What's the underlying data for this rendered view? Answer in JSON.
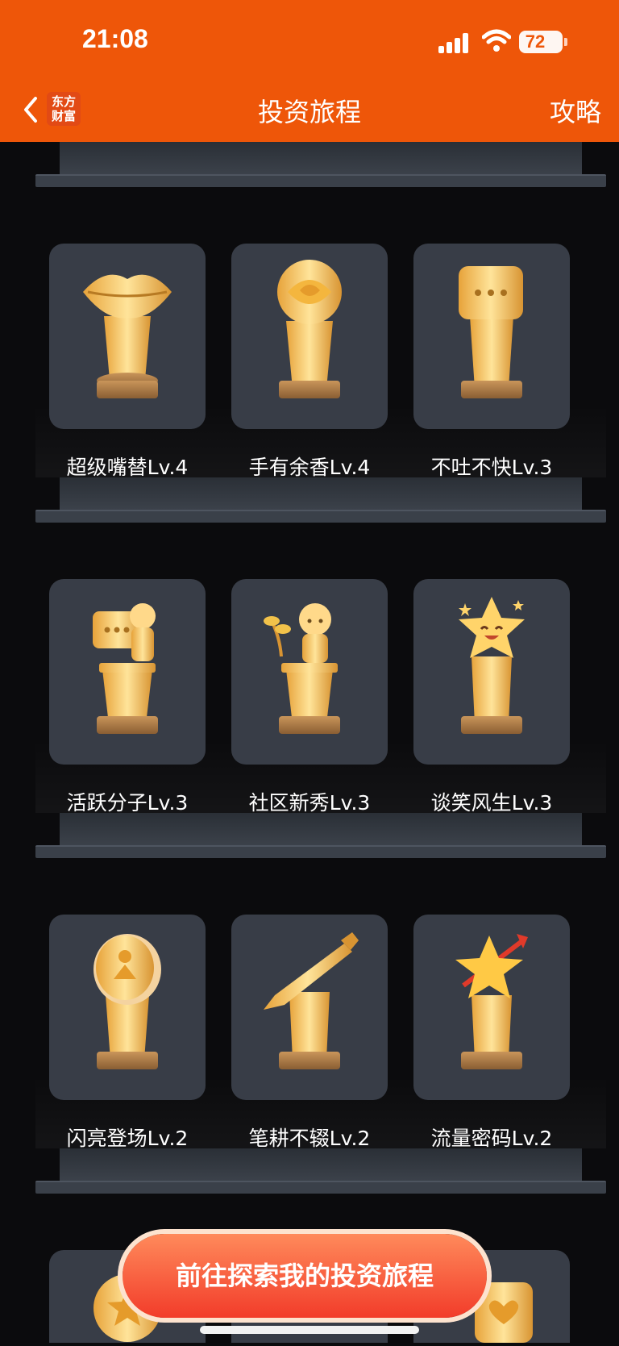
{
  "status": {
    "time": "21:08",
    "battery": "72"
  },
  "nav": {
    "logo": "东方财富",
    "title": "投资旅程",
    "action": "攻略"
  },
  "badges": [
    {
      "name": "超级嘴替Lv.4",
      "icon": "lips-trophy-icon"
    },
    {
      "name": "手有余香Lv.4",
      "icon": "rose-trophy-icon"
    },
    {
      "name": "不吐不快Lv.3",
      "icon": "speech-bubble-trophy-icon"
    },
    {
      "name": "活跃分子Lv.3",
      "icon": "kid-bubble-trophy-icon"
    },
    {
      "name": "社区新秀Lv.3",
      "icon": "kid-sprout-trophy-icon"
    },
    {
      "name": "谈笑风生Lv.3",
      "icon": "smiling-star-trophy-icon"
    },
    {
      "name": "闪亮登场Lv.2",
      "icon": "coin-trophy-icon"
    },
    {
      "name": "笔耕不辍Lv.2",
      "icon": "pen-trophy-icon"
    },
    {
      "name": "流量密码Lv.2",
      "icon": "star-arrow-trophy-icon"
    }
  ],
  "cta": {
    "label": "前往探索我的投资旅程"
  },
  "colors": {
    "brand": "#ee5609",
    "card": "#383d47",
    "gold": "#f2c24a"
  }
}
